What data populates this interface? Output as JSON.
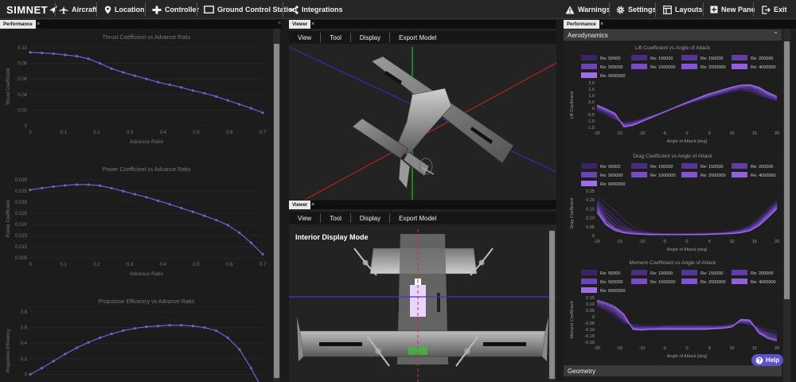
{
  "app": {
    "logo": "SIMNET"
  },
  "topbar": {
    "left": [
      {
        "label": "Aircraft",
        "icon": "plane-icon"
      },
      {
        "label": "Location",
        "icon": "location-pin-icon"
      },
      {
        "label": "Controller",
        "icon": "gamepad-icon"
      },
      {
        "label": "Ground Control Station",
        "icon": "monitor-icon"
      },
      {
        "label": "Integrations",
        "icon": "share-icon"
      }
    ],
    "right": [
      {
        "label": "Warnings",
        "icon": "warning-icon"
      },
      {
        "label": "Settings",
        "icon": "gear-icon"
      },
      {
        "label": "Layouts",
        "icon": "layout-icon"
      },
      {
        "label": "New Pane",
        "icon": "plus-icon"
      },
      {
        "label": "Exit",
        "icon": "exit-icon"
      }
    ]
  },
  "left_panel": {
    "tab": "Performance",
    "close": "×"
  },
  "viewer_top": {
    "tab": "Viewer",
    "close": "×",
    "menu": [
      "View",
      "Tool",
      "Display",
      "Export Model"
    ]
  },
  "viewer_bottom": {
    "tab": "Viewer",
    "close": "×",
    "menu": [
      "View",
      "Tool",
      "Display",
      "Export Model"
    ],
    "mode_label": "Interior Display Mode"
  },
  "right_panel": {
    "tab": "Performance",
    "close": "×",
    "section_aero": "Aerodynamics",
    "section_geometry": "Geometry",
    "legend": [
      "Re: 50000",
      "Re: 100000",
      "Re: 150000",
      "Re: 200000",
      "Re: 500000",
      "Re: 1000000",
      "Re: 2000000",
      "Re: 4000000",
      "Re: 6000000"
    ]
  },
  "help": {
    "label": "Help",
    "icon": "help-icon"
  },
  "colors": {
    "series": "#7a5bd1",
    "accent": "#5b54c8",
    "x_axis": "#e02020",
    "y_axis": "#20c020",
    "z_axis": "#2020c0"
  },
  "chart_data": [
    {
      "type": "line",
      "title": "Thrust Coefficient vs Advance Ratio",
      "xlabel": "Advance Ratio",
      "ylabel": "Thrust Coefficient",
      "xlim": [
        0,
        0.7
      ],
      "ylim": [
        -0.02,
        0.1
      ],
      "xticks": [
        "0",
        "0.1",
        "0.2",
        "0.3",
        "0.4",
        "0.5",
        "0.6",
        "0.7"
      ],
      "yticks": [
        "0.10",
        "0.08",
        "0.06",
        "0.04",
        "0.02",
        "0"
      ],
      "x": [
        0,
        0.035,
        0.07,
        0.105,
        0.14,
        0.175,
        0.21,
        0.245,
        0.28,
        0.315,
        0.35,
        0.385,
        0.42,
        0.455,
        0.49,
        0.525,
        0.56,
        0.595,
        0.63,
        0.665,
        0.7
      ],
      "values": [
        0.093,
        0.092,
        0.091,
        0.089,
        0.087,
        0.083,
        0.076,
        0.068,
        0.062,
        0.057,
        0.052,
        0.047,
        0.043,
        0.039,
        0.034,
        0.03,
        0.025,
        0.019,
        0.013,
        0.007,
        0.0
      ]
    },
    {
      "type": "line",
      "title": "Power Coefficient vs Advance Ratio",
      "xlabel": "Advance Ratio",
      "ylabel": "Power Coefficient",
      "xlim": [
        0,
        0.7
      ],
      "ylim": [
        0.0045,
        0.0355
      ],
      "xticks": [
        "0",
        "0.1",
        "0.2",
        "0.3",
        "0.4",
        "0.5",
        "0.6",
        "0.7"
      ],
      "yticks": [
        "0.030",
        "0.035",
        "0.030",
        "0.025",
        "0.020",
        "0.015",
        "0.010",
        "0.005"
      ],
      "x": [
        0,
        0.035,
        0.07,
        0.105,
        0.14,
        0.175,
        0.21,
        0.245,
        0.28,
        0.315,
        0.35,
        0.385,
        0.42,
        0.455,
        0.49,
        0.525,
        0.56,
        0.595,
        0.63,
        0.665,
        0.7
      ],
      "values": [
        0.0315,
        0.0322,
        0.0328,
        0.0333,
        0.0336,
        0.0336,
        0.0332,
        0.0322,
        0.031,
        0.0298,
        0.0286,
        0.0272,
        0.0258,
        0.0243,
        0.0228,
        0.0212,
        0.0195,
        0.0175,
        0.0145,
        0.0105,
        0.006
      ]
    },
    {
      "type": "line",
      "title": "Propulsive Efficiency vs Advance Ratio",
      "xlabel": "",
      "ylabel": "Propulsive Efficiency",
      "xlim": [
        0,
        0.7
      ],
      "ylim": [
        -0.2,
        0.8
      ],
      "xticks": [],
      "yticks": [
        "0.8",
        "0.6",
        "0.4",
        "0.2",
        "0",
        "-0.2"
      ],
      "x": [
        0,
        0.035,
        0.07,
        0.105,
        0.14,
        0.175,
        0.21,
        0.245,
        0.28,
        0.315,
        0.35,
        0.385,
        0.42,
        0.455,
        0.49,
        0.525,
        0.56,
        0.595,
        0.63,
        0.665,
        0.7
      ],
      "values": [
        0.0,
        0.08,
        0.17,
        0.26,
        0.34,
        0.41,
        0.47,
        0.52,
        0.56,
        0.59,
        0.61,
        0.62,
        0.63,
        0.63,
        0.62,
        0.6,
        0.56,
        0.47,
        0.32,
        0.08,
        -0.2
      ]
    },
    {
      "type": "line",
      "title": "Lift Coefficient vs Angle of Attack",
      "xlabel": "Angle of Attack [deg]",
      "ylabel": "Lift Coefficient",
      "xlim": [
        -20,
        20
      ],
      "ylim": [
        -1.5,
        2.0
      ],
      "xticks": [
        "-20",
        "-15",
        "-10",
        "-5",
        "0",
        "5",
        "10",
        "15",
        "20"
      ],
      "yticks": [
        "2.0",
        "1.5",
        "1.0",
        "0.5",
        "0",
        "-0.5",
        "-1.0",
        "-1.5"
      ],
      "x": [
        -20,
        -18,
        -16,
        -14,
        -12,
        -10,
        -8,
        -6,
        -4,
        -2,
        0,
        2,
        4,
        6,
        8,
        10,
        12,
        14,
        16,
        18,
        20
      ],
      "series": [
        {
          "values": [
            -0.2,
            -0.5,
            -0.9,
            -1.1,
            -1.0,
            -0.85,
            -0.6,
            -0.4,
            -0.15,
            0.1,
            0.35,
            0.55,
            0.75,
            0.95,
            1.15,
            1.3,
            1.4,
            1.3,
            1.0,
            0.8,
            0.6
          ]
        },
        {
          "values": [
            -0.1,
            -0.4,
            -0.8,
            -1.2,
            -1.1,
            -0.9,
            -0.65,
            -0.4,
            -0.15,
            0.1,
            0.35,
            0.6,
            0.8,
            1.0,
            1.2,
            1.4,
            1.5,
            1.4,
            1.1,
            0.85,
            0.65
          ]
        },
        {
          "values": [
            0.0,
            -0.3,
            -0.7,
            -1.25,
            -1.15,
            -0.92,
            -0.66,
            -0.4,
            -0.14,
            0.12,
            0.38,
            0.62,
            0.85,
            1.05,
            1.25,
            1.45,
            1.6,
            1.5,
            1.2,
            0.9,
            0.7
          ]
        },
        {
          "values": [
            0.05,
            -0.25,
            -0.6,
            -1.3,
            -1.2,
            -0.95,
            -0.68,
            -0.41,
            -0.14,
            0.13,
            0.4,
            0.65,
            0.88,
            1.1,
            1.3,
            1.5,
            1.65,
            1.6,
            1.3,
            1.0,
            0.75
          ]
        },
        {
          "values": [
            0.1,
            -0.2,
            -0.55,
            -1.35,
            -1.25,
            -0.98,
            -0.7,
            -0.42,
            -0.14,
            0.14,
            0.42,
            0.68,
            0.92,
            1.15,
            1.35,
            1.55,
            1.7,
            1.7,
            1.4,
            1.05,
            0.8
          ]
        },
        {
          "values": [
            0.15,
            -0.15,
            -0.5,
            -1.4,
            -1.28,
            -1.0,
            -0.72,
            -0.43,
            -0.14,
            0.15,
            0.44,
            0.7,
            0.95,
            1.18,
            1.4,
            1.6,
            1.75,
            1.75,
            1.5,
            1.1,
            0.85
          ]
        },
        {
          "values": [
            0.2,
            -0.1,
            -0.45,
            -1.42,
            -1.3,
            -1.02,
            -0.73,
            -0.44,
            -0.14,
            0.16,
            0.45,
            0.72,
            0.98,
            1.2,
            1.42,
            1.62,
            1.78,
            1.8,
            1.55,
            1.15,
            0.88
          ]
        },
        {
          "values": [
            0.22,
            -0.08,
            -0.42,
            -1.45,
            -1.32,
            -1.04,
            -0.74,
            -0.44,
            -0.14,
            0.16,
            0.46,
            0.74,
            1.0,
            1.22,
            1.44,
            1.64,
            1.8,
            1.82,
            1.6,
            1.2,
            0.9
          ]
        },
        {
          "values": [
            0.25,
            -0.05,
            -0.4,
            -1.48,
            -1.35,
            -1.05,
            -0.75,
            -0.45,
            -0.15,
            0.17,
            0.47,
            0.75,
            1.02,
            1.25,
            1.46,
            1.66,
            1.82,
            1.85,
            1.65,
            1.25,
            0.92
          ]
        }
      ]
    },
    {
      "type": "line",
      "title": "Drag Coefficient vs Angle of Attack",
      "xlabel": "Angle of Attack [deg]",
      "ylabel": "Drag Coefficient",
      "xlim": [
        -20,
        20
      ],
      "ylim": [
        0,
        0.25
      ],
      "xticks": [
        "-20",
        "-15",
        "-10",
        "-5",
        "0",
        "5",
        "10",
        "15",
        "20"
      ],
      "yticks": [
        "0.25",
        "0.20",
        "0.15",
        "0.10",
        "0.05",
        "0"
      ],
      "x": [
        -20,
        -18,
        -16,
        -14,
        -12,
        -10,
        -8,
        -6,
        -4,
        -2,
        0,
        2,
        4,
        6,
        8,
        10,
        12,
        14,
        16,
        18,
        20
      ],
      "series": [
        {
          "values": [
            0.22,
            0.18,
            0.14,
            0.09,
            0.05,
            0.025,
            0.015,
            0.012,
            0.011,
            0.011,
            0.011,
            0.012,
            0.013,
            0.015,
            0.018,
            0.024,
            0.035,
            0.06,
            0.1,
            0.15,
            0.2
          ]
        },
        {
          "values": [
            0.2,
            0.15,
            0.1,
            0.06,
            0.03,
            0.018,
            0.012,
            0.01,
            0.009,
            0.009,
            0.009,
            0.01,
            0.011,
            0.013,
            0.016,
            0.021,
            0.03,
            0.05,
            0.09,
            0.14,
            0.19
          ]
        },
        {
          "values": [
            0.19,
            0.13,
            0.08,
            0.045,
            0.022,
            0.014,
            0.01,
            0.009,
            0.008,
            0.008,
            0.008,
            0.009,
            0.01,
            0.012,
            0.014,
            0.019,
            0.027,
            0.045,
            0.08,
            0.13,
            0.18
          ]
        },
        {
          "values": [
            0.18,
            0.11,
            0.06,
            0.035,
            0.018,
            0.012,
            0.009,
            0.008,
            0.007,
            0.007,
            0.007,
            0.008,
            0.009,
            0.011,
            0.013,
            0.017,
            0.024,
            0.04,
            0.075,
            0.125,
            0.175
          ]
        },
        {
          "values": [
            0.17,
            0.09,
            0.045,
            0.025,
            0.014,
            0.01,
            0.008,
            0.007,
            0.006,
            0.006,
            0.006,
            0.007,
            0.008,
            0.01,
            0.012,
            0.015,
            0.021,
            0.035,
            0.07,
            0.12,
            0.17
          ]
        },
        {
          "values": [
            0.16,
            0.08,
            0.04,
            0.02,
            0.012,
            0.009,
            0.007,
            0.006,
            0.006,
            0.006,
            0.006,
            0.006,
            0.007,
            0.009,
            0.011,
            0.014,
            0.019,
            0.032,
            0.065,
            0.115,
            0.165
          ]
        },
        {
          "values": [
            0.15,
            0.07,
            0.035,
            0.018,
            0.011,
            0.008,
            0.006,
            0.006,
            0.005,
            0.005,
            0.005,
            0.006,
            0.007,
            0.008,
            0.01,
            0.013,
            0.018,
            0.03,
            0.06,
            0.11,
            0.16
          ]
        },
        {
          "values": [
            0.14,
            0.065,
            0.03,
            0.016,
            0.01,
            0.007,
            0.006,
            0.005,
            0.005,
            0.005,
            0.005,
            0.005,
            0.006,
            0.008,
            0.01,
            0.012,
            0.017,
            0.028,
            0.058,
            0.105,
            0.155
          ]
        },
        {
          "values": [
            0.13,
            0.06,
            0.028,
            0.015,
            0.009,
            0.007,
            0.005,
            0.005,
            0.005,
            0.005,
            0.005,
            0.005,
            0.006,
            0.007,
            0.009,
            0.011,
            0.016,
            0.027,
            0.055,
            0.1,
            0.15
          ]
        }
      ]
    },
    {
      "type": "line",
      "title": "Moment Coefficient vs Angle of Attack",
      "xlabel": "Angle of Attack [deg]",
      "ylabel": "Moment Coefficient",
      "xlim": [
        -20,
        20
      ],
      "ylim": [
        -0.2,
        0.15
      ],
      "xticks": [
        "-20",
        "-15",
        "-10",
        "-5",
        "0",
        "5",
        "10",
        "15",
        "20"
      ],
      "yticks": [
        "0.15",
        "0.10",
        "0.05",
        "0",
        "-0.05",
        "-0.10",
        "-0.15",
        "-0.20"
      ],
      "x": [
        -20,
        -18,
        -16,
        -14,
        -12,
        -10,
        -8,
        -6,
        -4,
        -2,
        0,
        2,
        4,
        6,
        8,
        10,
        12,
        14,
        16,
        18,
        20
      ],
      "series": [
        {
          "values": [
            0.08,
            0.05,
            0.0,
            -0.05,
            -0.06,
            -0.07,
            -0.07,
            -0.07,
            -0.07,
            -0.07,
            -0.07,
            -0.07,
            -0.07,
            -0.07,
            -0.07,
            -0.06,
            -0.05,
            -0.06,
            -0.08,
            -0.1,
            -0.12
          ]
        },
        {
          "values": [
            0.09,
            0.06,
            0.02,
            -0.04,
            -0.07,
            -0.08,
            -0.08,
            -0.08,
            -0.075,
            -0.075,
            -0.075,
            -0.075,
            -0.075,
            -0.075,
            -0.075,
            -0.065,
            -0.045,
            -0.06,
            -0.09,
            -0.12,
            -0.14
          ]
        },
        {
          "values": [
            0.1,
            0.07,
            0.03,
            -0.03,
            -0.08,
            -0.085,
            -0.085,
            -0.08,
            -0.08,
            -0.08,
            -0.08,
            -0.08,
            -0.08,
            -0.08,
            -0.08,
            -0.07,
            -0.04,
            -0.05,
            -0.1,
            -0.13,
            -0.15
          ]
        },
        {
          "values": [
            0.11,
            0.08,
            0.04,
            -0.02,
            -0.085,
            -0.09,
            -0.09,
            -0.085,
            -0.085,
            -0.085,
            -0.085,
            -0.085,
            -0.085,
            -0.085,
            -0.08,
            -0.07,
            -0.035,
            -0.045,
            -0.11,
            -0.14,
            -0.16
          ]
        },
        {
          "values": [
            0.11,
            0.09,
            0.05,
            -0.01,
            -0.09,
            -0.095,
            -0.09,
            -0.09,
            -0.09,
            -0.09,
            -0.09,
            -0.09,
            -0.09,
            -0.09,
            -0.085,
            -0.075,
            -0.03,
            -0.04,
            -0.11,
            -0.15,
            -0.17
          ]
        },
        {
          "values": [
            0.12,
            0.1,
            0.06,
            0.0,
            -0.09,
            -0.1,
            -0.095,
            -0.09,
            -0.09,
            -0.09,
            -0.09,
            -0.09,
            -0.09,
            -0.09,
            -0.085,
            -0.075,
            -0.03,
            -0.035,
            -0.12,
            -0.16,
            -0.18
          ]
        },
        {
          "values": [
            0.12,
            0.1,
            0.07,
            0.01,
            -0.095,
            -0.1,
            -0.095,
            -0.095,
            -0.095,
            -0.095,
            -0.095,
            -0.095,
            -0.095,
            -0.09,
            -0.09,
            -0.08,
            -0.025,
            -0.03,
            -0.12,
            -0.16,
            -0.18
          ]
        },
        {
          "values": [
            0.12,
            0.1,
            0.07,
            0.015,
            -0.095,
            -0.1,
            -0.1,
            -0.095,
            -0.095,
            -0.095,
            -0.095,
            -0.095,
            -0.095,
            -0.09,
            -0.09,
            -0.08,
            -0.025,
            -0.03,
            -0.12,
            -0.17,
            -0.19
          ]
        },
        {
          "values": [
            0.13,
            0.11,
            0.08,
            0.02,
            -0.1,
            -0.105,
            -0.1,
            -0.1,
            -0.1,
            -0.1,
            -0.1,
            -0.1,
            -0.1,
            -0.095,
            -0.09,
            -0.08,
            -0.02,
            -0.025,
            -0.13,
            -0.17,
            -0.19
          ]
        }
      ]
    }
  ]
}
